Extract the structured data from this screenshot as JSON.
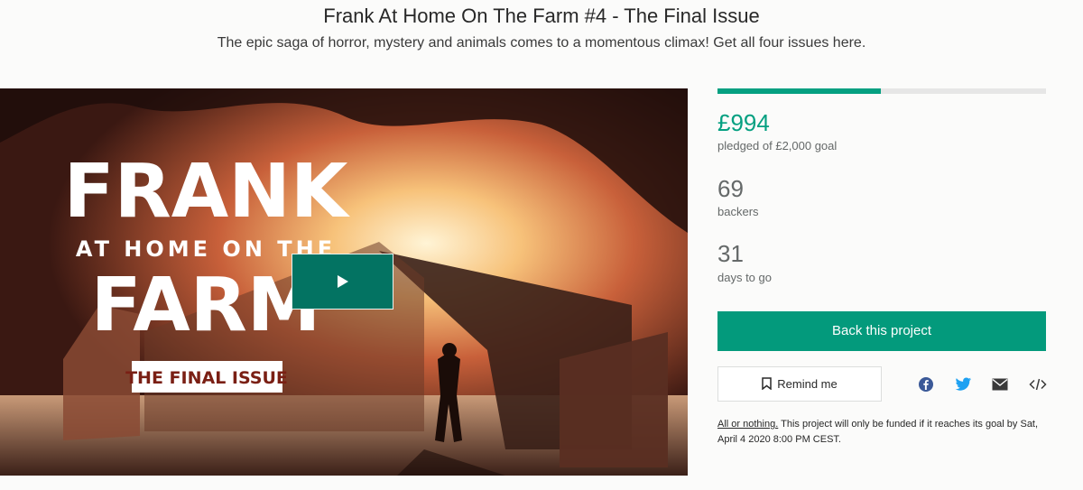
{
  "header": {
    "title": "Frank At Home On The Farm #4 - The Final Issue",
    "subtitle": "The epic saga of horror, mystery and animals comes to a momentous climax! Get all four issues here."
  },
  "media": {
    "art_title_line1": "FRANK",
    "art_title_line2": "AT HOME ON THE",
    "art_title_line3": "FARM",
    "art_badge": "THE FINAL ISSUE",
    "play_icon": "play-icon"
  },
  "funding": {
    "progress_fraction": 0.497,
    "pledged": "£994",
    "pledged_label": "pledged of £2,000 goal",
    "backers": "69",
    "backers_label": "backers",
    "days": "31",
    "days_label": "days to go"
  },
  "actions": {
    "back_label": "Back this project",
    "remind_label": "Remind me",
    "share_icons": [
      "facebook-icon",
      "twitter-icon",
      "email-icon",
      "embed-icon"
    ]
  },
  "note": {
    "link_text": "All or nothing.",
    "text": "This project will only be funded if it reaches its goal by Sat, April 4 2020 8:00 PM CEST."
  },
  "colors": {
    "accent": "#05a081",
    "button": "#039a7c",
    "play_button": "#037362"
  }
}
